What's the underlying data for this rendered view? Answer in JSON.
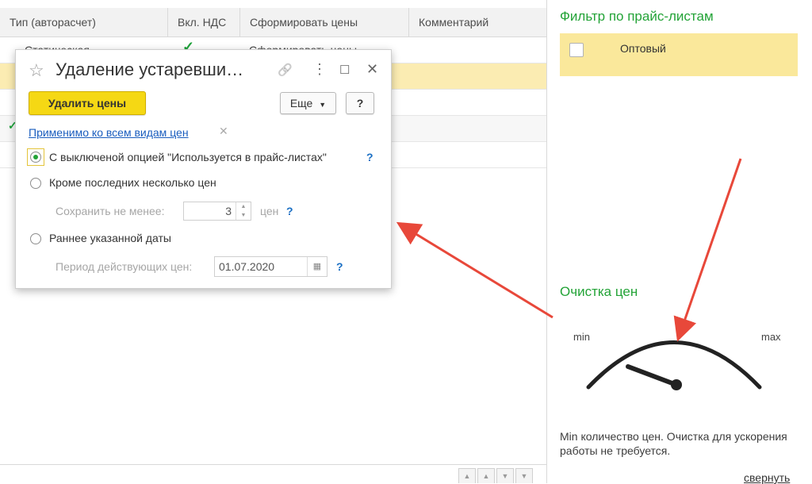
{
  "table": {
    "columns": [
      "Тип (авторасчет)",
      "Вкл. НДС",
      "Сформировать цены",
      "Комментарий"
    ],
    "row1": {
      "type": "Статическая",
      "form": "Сформировать цены"
    }
  },
  "nav": {
    "first": "▲",
    "up": "▲",
    "down": "▼",
    "last": "▼"
  },
  "right_panel": {
    "filter_title": "Фильтр по прайс-листам",
    "filter_item": "Оптовый",
    "cleanup_title": "Очистка цен",
    "gauge": {
      "min_label": "min",
      "max_label": "max"
    },
    "note": "Min количество цен. Очистка для ускорения работы не требуется.",
    "collapse": "свернуть"
  },
  "dialog": {
    "title": "Удаление устаревши…",
    "icons": {
      "star": "☆",
      "link": "🔗",
      "more": "⋮",
      "maximize": "☐",
      "close": "✕"
    },
    "delete_button": "Удалить цены",
    "more_button": "Еще",
    "help_button": "?",
    "applies_link": "Применимо ко всем видам цен",
    "clear_icon": "✕",
    "options": {
      "opt1": "С выключеной опцией \"Используется в прайс-листах\"",
      "opt2": "Кроме последних несколько цен",
      "opt3": "Раннее указанной даты"
    },
    "help_mark": "?",
    "keep_label": "Сохранить не менее:",
    "keep_value": "3",
    "keep_unit": "цен",
    "period_label": "Период действующих цен:",
    "period_value": "01.07.2020"
  },
  "colors": {
    "accent_green": "#23a337",
    "selection": "#fbecb2",
    "button_yellow": "#f5d814",
    "arrow_red": "#e8483a"
  }
}
